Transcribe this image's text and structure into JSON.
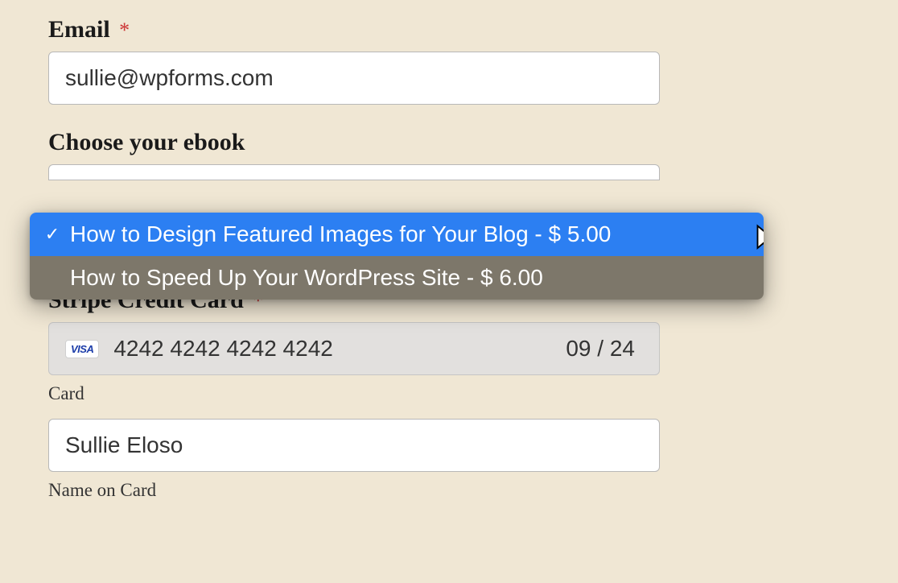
{
  "email": {
    "label": "Email",
    "value": "sullie@wpforms.com",
    "required_mark": "*"
  },
  "ebook": {
    "label": "Choose your ebook",
    "options": [
      {
        "text": "How to Design Featured Images for Your Blog - $ 5.00",
        "selected": true
      },
      {
        "text": "How to Speed Up Your WordPress Site - $ 6.00",
        "selected": false
      }
    ]
  },
  "stripe": {
    "label": "Stripe Credit Card",
    "required_mark": "*",
    "card_brand": "VISA",
    "card_number": "4242 4242 4242 4242",
    "card_expiry": "09 / 24",
    "card_sublabel": "Card",
    "name_value": "Sullie Eloso",
    "name_sublabel": "Name on Card"
  },
  "colors": {
    "background": "#f0e7d4",
    "highlight": "#2c7ff2",
    "dropdown_unselected": "#7d776a",
    "required": "#cc3333"
  }
}
